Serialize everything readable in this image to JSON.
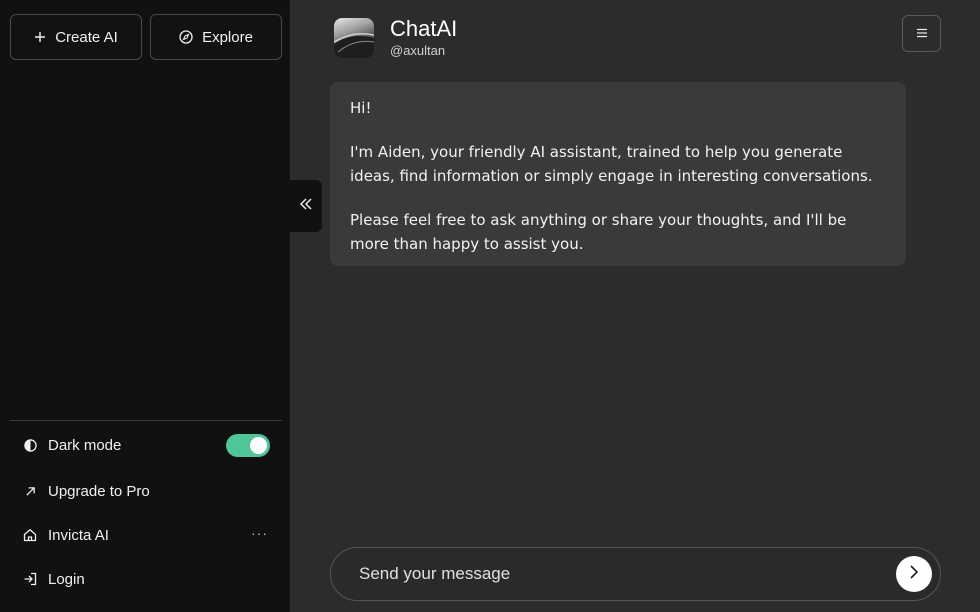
{
  "sidebar": {
    "create_label": "Create AI",
    "explore_label": "Explore",
    "dark_mode_label": "Dark mode",
    "dark_mode_on": true,
    "upgrade_label": "Upgrade to Pro",
    "workspace_label": "Invicta AI",
    "workspace_more": "···",
    "login_label": "Login"
  },
  "header": {
    "title": "ChatAI",
    "handle": "@axultan"
  },
  "message": {
    "greeting": "Hi!",
    "intro": "I'm Aiden, your friendly AI assistant, trained to help you generate ideas, find information or simply engage in interesting conversations.",
    "invite": "Please feel free to ask anything or share your thoughts, and I'll be more than happy to assist you."
  },
  "composer": {
    "placeholder": "Send your message"
  },
  "icons": {
    "create": "plus-icon",
    "explore": "compass-icon",
    "dark_mode": "contrast-icon",
    "upgrade": "arrow-up-right-icon",
    "workspace": "home-icon",
    "login": "login-icon",
    "collapse": "double-chevron-left-icon",
    "menu": "hamburger-icon",
    "send": "chevron-right-icon"
  },
  "colors": {
    "toggle_on": "#4fc598",
    "sidebar_bg": "#111111",
    "main_bg": "#2c2c2e",
    "bubble_bg": "#3a3a3d"
  }
}
